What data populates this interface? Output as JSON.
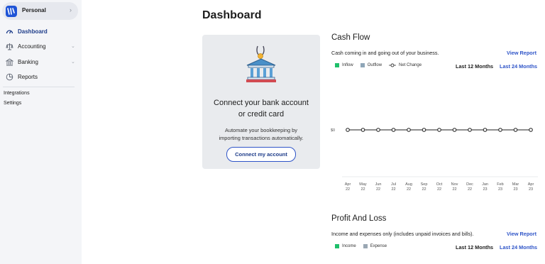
{
  "sidebar": {
    "business_name": "Personal",
    "items": [
      {
        "label": "Dashboard",
        "icon": "gauge-icon",
        "active": true
      },
      {
        "label": "Accounting",
        "icon": "scale-icon",
        "expandable": true
      },
      {
        "label": "Banking",
        "icon": "bank-icon",
        "expandable": true
      },
      {
        "label": "Reports",
        "icon": "pie-chart-icon"
      }
    ],
    "links": [
      "Integrations",
      "Settings"
    ]
  },
  "main": {
    "title": "Dashboard",
    "connect_card": {
      "title_line1": "Connect your bank account",
      "title_line2": "or credit card",
      "desc_line1": "Automate your bookkeeping by",
      "desc_line2": "importing transactions automatically.",
      "button": "Connect my account"
    },
    "cash_flow": {
      "title": "Cash Flow",
      "subtitle": "Cash coming in and going out of your business.",
      "view_report": "View Report",
      "legend": [
        "Inflow",
        "Outflow",
        "Net Change"
      ],
      "range_12": "Last 12 Months",
      "range_24": "Last 24 Months"
    },
    "profit_loss": {
      "title": "Profit And Loss",
      "subtitle": "Income and expenses only (includes unpaid invoices and bills).",
      "view_report": "View Report",
      "legend": [
        "Income",
        "Expense"
      ],
      "range_12": "Last 12 Months",
      "range_24": "Last 24 Months"
    }
  },
  "colors": {
    "accent": "#2f55c8",
    "nav_active": "#1f3d8a",
    "inflow": "#1fbf6a",
    "outflow": "#8fa6b8",
    "income": "#1fbf6a",
    "expense": "#9aa7b3"
  },
  "chart_data": {
    "type": "line",
    "categories": [
      [
        "Apr",
        "22"
      ],
      [
        "May",
        "22"
      ],
      [
        "Jun",
        "22"
      ],
      [
        "Jul",
        "22"
      ],
      [
        "Aug",
        "22"
      ],
      [
        "Sep",
        "22"
      ],
      [
        "Oct",
        "22"
      ],
      [
        "Nov",
        "22"
      ],
      [
        "Dec",
        "22"
      ],
      [
        "Jan",
        "23"
      ],
      [
        "Feb",
        "23"
      ],
      [
        "Mar",
        "23"
      ],
      [
        "Apr",
        "23"
      ]
    ],
    "series": [
      {
        "name": "Inflow",
        "values": [
          0,
          0,
          0,
          0,
          0,
          0,
          0,
          0,
          0,
          0,
          0,
          0,
          0
        ]
      },
      {
        "name": "Outflow",
        "values": [
          0,
          0,
          0,
          0,
          0,
          0,
          0,
          0,
          0,
          0,
          0,
          0,
          0
        ]
      },
      {
        "name": "Net Change",
        "values": [
          0,
          0,
          0,
          0,
          0,
          0,
          0,
          0,
          0,
          0,
          0,
          0,
          0
        ]
      }
    ],
    "y_tick_label": "$0",
    "grid": false
  }
}
